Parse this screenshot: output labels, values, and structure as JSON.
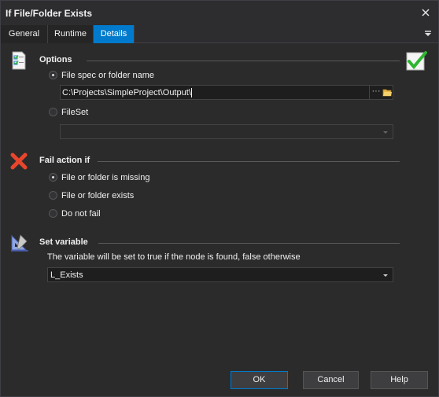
{
  "window": {
    "title": "If File/Folder Exists"
  },
  "tabs": [
    {
      "label": "General"
    },
    {
      "label": "Runtime"
    },
    {
      "label": "Details"
    }
  ],
  "options": {
    "title": "Options",
    "file_spec_label": "File spec or folder name",
    "file_spec_value": "C:\\Projects\\SimpleProject\\Output\\",
    "browse_dots": "···",
    "fileset_label": "FileSet",
    "fileset_value": ""
  },
  "fail_action": {
    "title": "Fail action if",
    "opt_missing": "File or folder is missing",
    "opt_exists": "File or folder exists",
    "opt_none": "Do not fail"
  },
  "set_variable": {
    "title": "Set variable",
    "description": "The variable will be set to true if the node is found, false otherwise",
    "value": "L_Exists"
  },
  "buttons": {
    "ok": "OK",
    "cancel": "Cancel",
    "help": "Help"
  },
  "colors": {
    "accent": "#007acc",
    "check_green": "#2fb52f",
    "fail_red": "#e8462c"
  }
}
